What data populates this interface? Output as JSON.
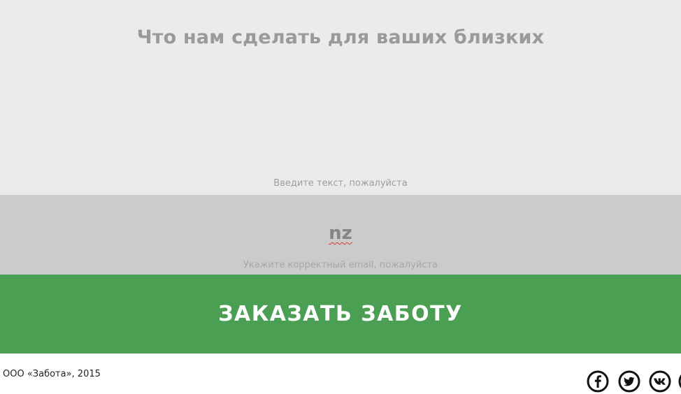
{
  "form": {
    "message_placeholder": "Что нам сделать для ваших близких",
    "message_hint": "Введите текст, пожалуйста",
    "email_value": "nz",
    "email_hint": "Укажите корректный email, пожалуйста",
    "submit_label": "ЗАКАЗАТЬ ЗАБОТУ"
  },
  "footer": {
    "copyright": "ООО «Забота», 2015",
    "social": [
      "facebook-icon",
      "twitter-icon",
      "vk-icon"
    ]
  },
  "colors": {
    "textarea_bg": "#ebebeb",
    "email_bg": "#cbcbcb",
    "accent_green": "#4a9f52",
    "error_underline": "#d23b3b"
  }
}
